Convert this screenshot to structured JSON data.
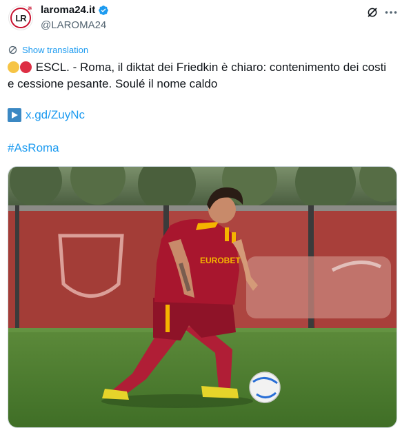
{
  "author": {
    "display_name": "laroma24.it",
    "handle": "@LAROMA24",
    "avatar_text": "LR",
    "avatar_tiny": "24",
    "verified": true
  },
  "actions": {
    "grok_icon": "grok-icon",
    "more_icon": "more-icon"
  },
  "translation": {
    "label": "Show translation"
  },
  "tweet": {
    "emoji": [
      "yellow-circle",
      "red-circle"
    ],
    "text": "ESCL. - Roma, il diktat dei Friedkin è chiaro: contenimento dei costi e cessione pesante. Soulé il nome caldo",
    "link": "x.gd/ZuyNc",
    "hashtag": "#AsRoma"
  },
  "media": {
    "jersey_text": "EUROBET"
  },
  "colors": {
    "accent": "#1d9bf0",
    "text": "#0f1419",
    "muted": "#536471",
    "roma_red": "#a4142c",
    "roma_gold": "#f5b400"
  }
}
